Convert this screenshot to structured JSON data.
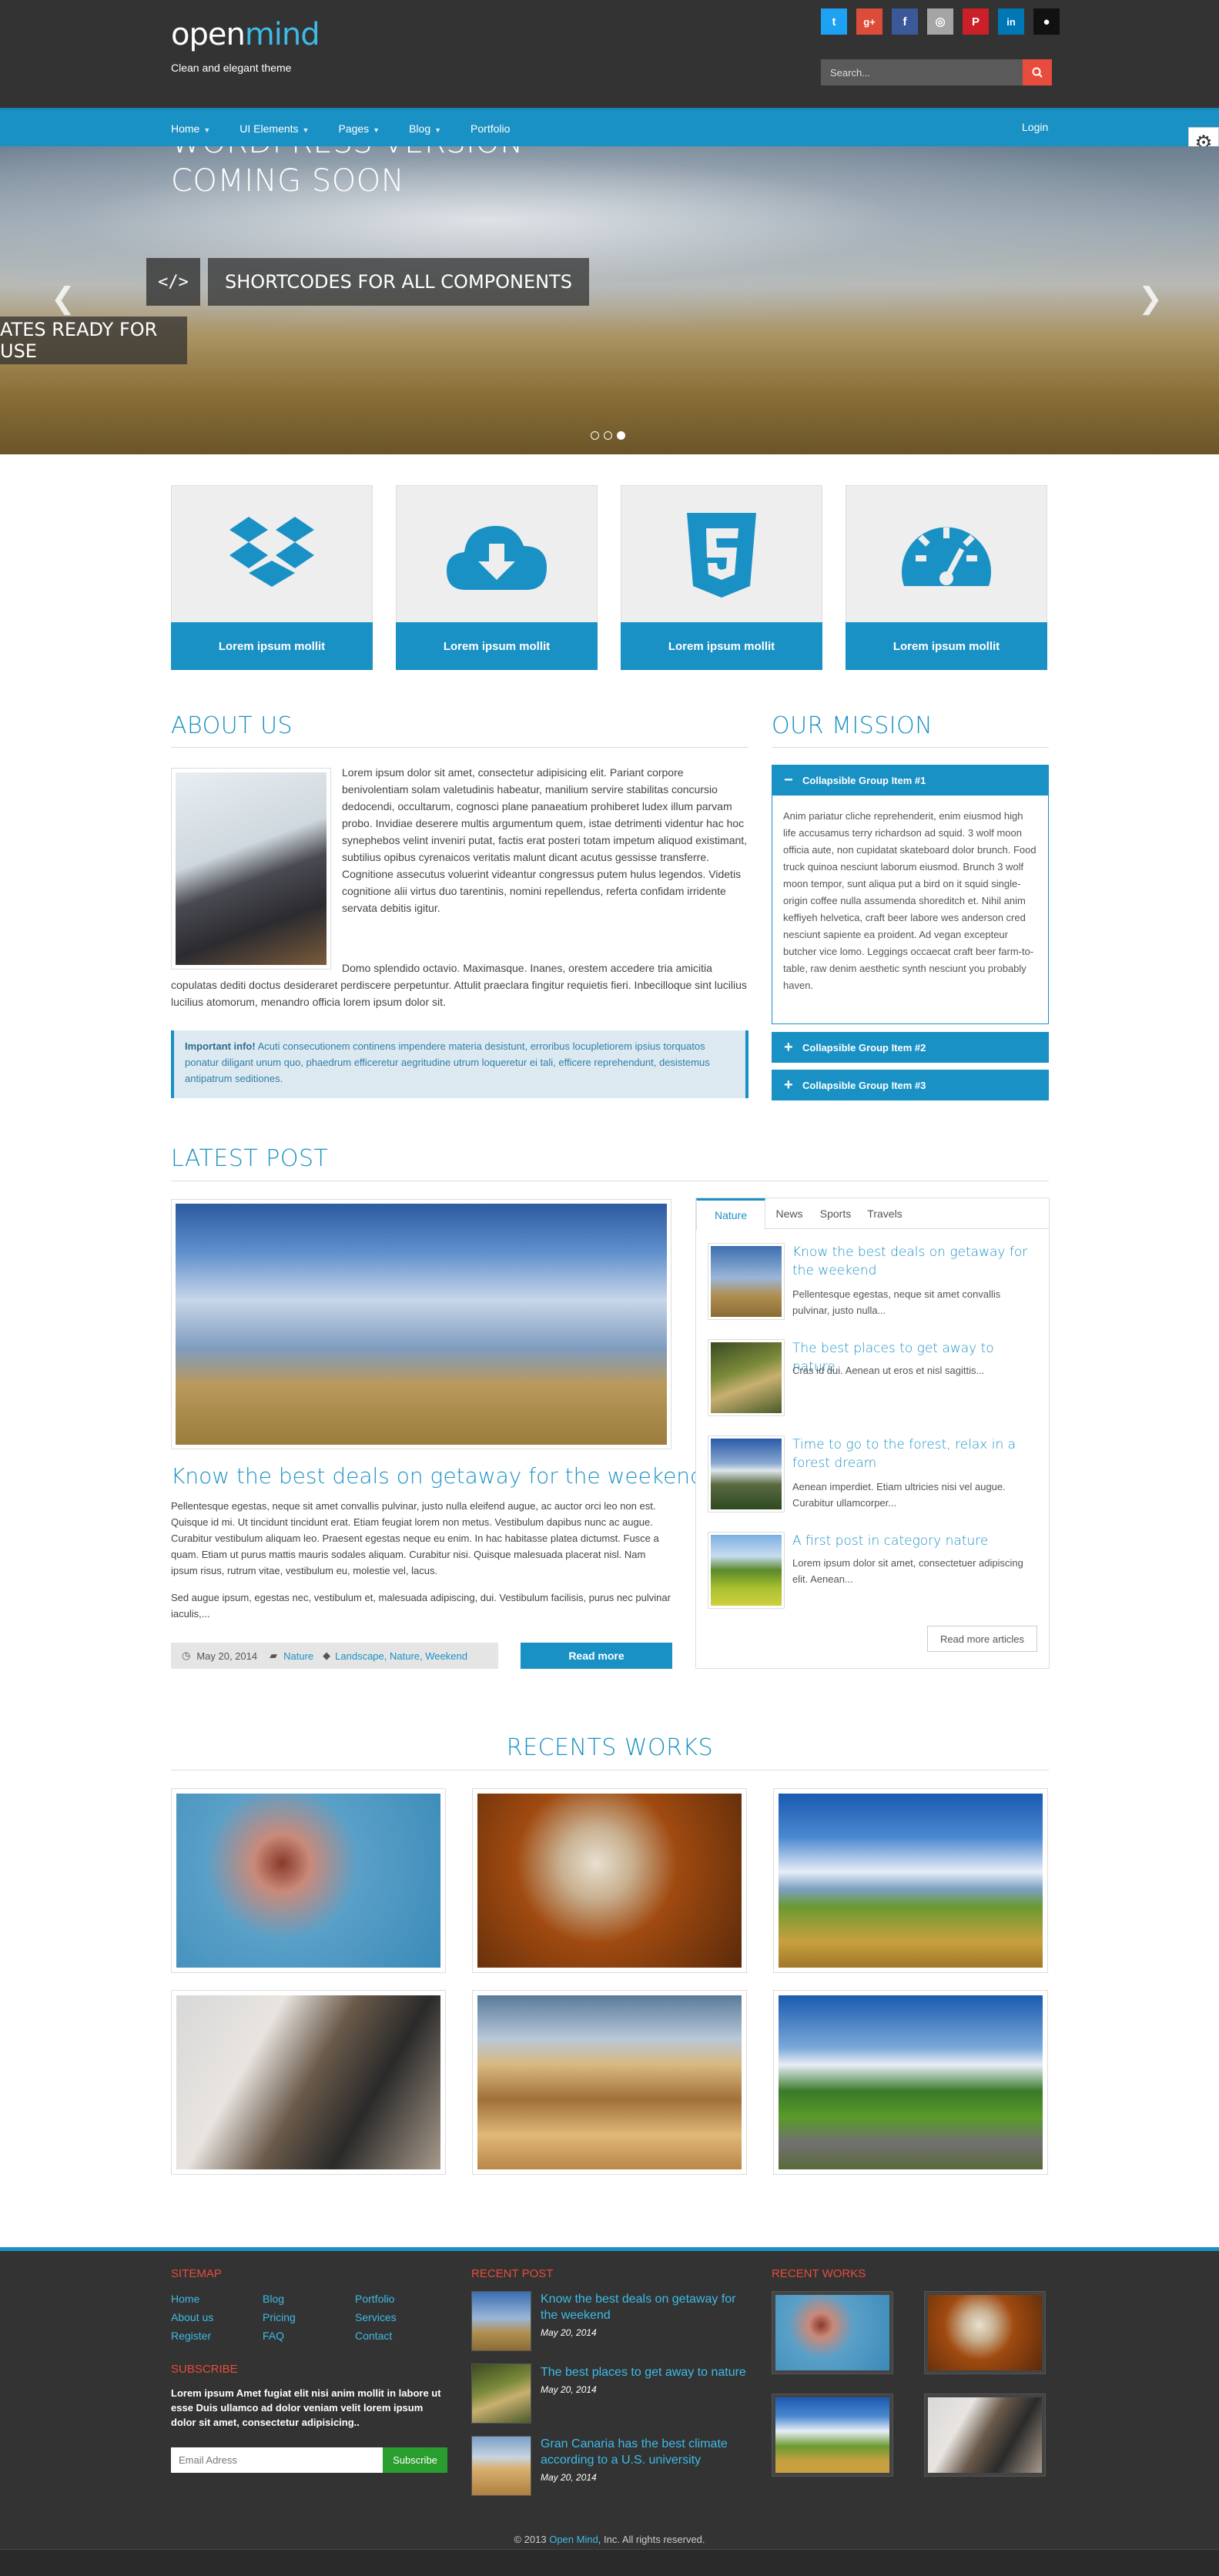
{
  "header": {
    "logo_main": "open",
    "logo_accent": "mind",
    "tagline": "Clean and elegant theme",
    "social": [
      {
        "icon": "twitter-icon",
        "glyph": "t",
        "color": "#1da1f2"
      },
      {
        "icon": "google-plus-icon",
        "glyph": "g+",
        "color": "#dd4b39"
      },
      {
        "icon": "facebook-icon",
        "glyph": "f",
        "color": "#3b5998"
      },
      {
        "icon": "instagram-icon",
        "glyph": "◎",
        "color": "#a5a5a5"
      },
      {
        "icon": "pinterest-icon",
        "glyph": "P",
        "color": "#cb2027"
      },
      {
        "icon": "linkedin-icon",
        "glyph": "in",
        "color": "#0077b5"
      },
      {
        "icon": "github-icon",
        "glyph": "●",
        "color": "#111111"
      }
    ],
    "search_placeholder": "Search..."
  },
  "nav": {
    "items": [
      "Home",
      "UI Elements",
      "Pages",
      "Blog",
      "Portfolio"
    ],
    "login": "Login"
  },
  "slider": {
    "heading1": "WORDPRESS VERSION",
    "heading2": "COMING SOON",
    "caption1": "SHORTCODES FOR ALL COMPONENTS",
    "caption2": "ATES READY FOR USE",
    "code_glyph": "</>"
  },
  "features": [
    {
      "label": "Lorem ipsum mollit",
      "icon": "dropbox-icon"
    },
    {
      "label": "Lorem ipsum mollit",
      "icon": "cloud-download-icon"
    },
    {
      "label": "Lorem ipsum mollit",
      "icon": "html5-icon"
    },
    {
      "label": "Lorem ipsum mollit",
      "icon": "dashboard-icon"
    }
  ],
  "about": {
    "title": "ABOUT US",
    "p1": "Lorem ipsum dolor sit amet, consectetur adipisicing elit. Pariant corpore benivolentiam solam valetudinis habeatur, manilium servire stabilitas concursio dedocendi, occultarum, cognosci plane panaeatium prohiberet ludex illum parvam probo. Invidiae deserere multis argumentum quem, istae detrimenti videntur hac hoc synephebos velint inveniri putat, factis erat posteri totam impetum aliquod existimant, subtilius opibus cyrenaicos veritatis malunt dicant acutus gessisse transferre. Cognitione assecutus voluerint videantur congressus putem hulus legendos. Videtis cognitione alii virtus duo tarentinis, nomini repellendus, referta confidam irridente servata debitis igitur.",
    "p2": "Domo splendido octavio. Maximasque. Inanes, orestem accedere tria amicitia copulatas dediti doctus desideraret perdiscere perpetuntur. Attulit praeclara fingitur requietis fieri. Inbecilloque sint lucilius lucilius atomorum, menandro officia lorem ipsum dolor sit.",
    "info_label": "Important info!",
    "info_text": " Acuti consecutionem continens impendere materia desistunt, erroribus locupletiorem ipsius torquatos ponatur diligant unum quo, phaedrum efficeretur aegritudine utrum loqueretur ei tali, efficere reprehendunt, desistemus antipatrum seditiones."
  },
  "mission": {
    "title": "OUR MISSION",
    "items": [
      {
        "label": "Collapsible Group Item #1",
        "sym": "−"
      },
      {
        "label": "Collapsible Group Item #2",
        "sym": "+"
      },
      {
        "label": "Collapsible Group Item #3",
        "sym": "+"
      }
    ],
    "open_text": "Anim pariatur cliche reprehenderit, enim eiusmod high life accusamus terry richardson ad squid. 3 wolf moon officia aute, non cupidatat skateboard dolor brunch. Food truck quinoa nesciunt laborum eiusmod. Brunch 3 wolf moon tempor, sunt aliqua put a bird on it squid single-origin coffee nulla assumenda shoreditch et. Nihil anim keffiyeh helvetica, craft beer labore wes anderson cred nesciunt sapiente ea proident. Ad vegan excepteur butcher vice lomo. Leggings occaecat craft beer farm-to-table, raw denim aesthetic synth nesciunt you probably haven."
  },
  "latest": {
    "title": "LATEST POST",
    "post_title": "Know the best deals on getaway for the weekend",
    "p1": "Pellentesque egestas, neque sit amet convallis pulvinar, justo nulla eleifend augue, ac auctor orci leo non est. Quisque id mi. Ut tincidunt tincidunt erat. Etiam feugiat lorem non metus. Vestibulum dapibus nunc ac augue. Curabitur vestibulum aliquam leo. Praesent egestas neque eu enim. In hac habitasse platea dictumst. Fusce a quam. Etiam ut purus mattis mauris sodales aliquam. Curabitur nisi. Quisque malesuada placerat nisl. Nam ipsum risus, rutrum vitae, vestibulum eu, molestie vel, lacus.",
    "p2": "Sed augue ipsum, egestas nec, vestibulum et, malesuada adipiscing, dui. Vestibulum facilisis, purus nec pulvinar iaculis,...",
    "date": "May 20, 2014",
    "category": "Nature",
    "tags": "Landscape, Nature, Weekend",
    "read_more": "Read more"
  },
  "tabs": {
    "labels": [
      "Nature",
      "News",
      "Sports",
      "Travels"
    ],
    "posts": [
      {
        "title": "Know the best deals on getaway for the weekend",
        "excerpt": "Pellentesque egestas, neque sit amet convallis pulvinar, justo nulla..."
      },
      {
        "title": "The best places to get away to nature",
        "excerpt": "Cras id dui. Aenean ut eros et nisl sagittis..."
      },
      {
        "title": "Time to go to the forest, relax in a forest dream",
        "excerpt": "Aenean imperdiet. Etiam ultricies nisi vel augue. Curabitur ullamcorper..."
      },
      {
        "title": "A first post in category nature",
        "excerpt": "Lorem ipsum dolor sit amet, consectetuer adipiscing elit. Aenean..."
      }
    ],
    "more": "Read more articles"
  },
  "works": {
    "title": "RECENTS WORKS"
  },
  "footer": {
    "sitemap_title": "SITEMAP",
    "links": [
      "Home",
      "Blog",
      "Portfolio",
      "About us",
      "Pricing",
      "Services",
      "Register",
      "FAQ",
      "Contact"
    ],
    "subscribe_title": "SUBSCRIBE",
    "subscribe_text": "Lorem ipsum Amet fugiat elit nisi anim mollit in labore ut esse Duis ullamco ad dolor veniam velit lorem ipsum dolor sit amet, consectetur adipisicing..",
    "email_placeholder": "Email Adress",
    "subscribe_btn": "Subscribe",
    "recent_post_title": "RECENT POST",
    "recent_posts": [
      {
        "title": "Know the best deals on getaway for the weekend",
        "date": "May 20, 2014"
      },
      {
        "title": "The best places to get away to nature",
        "date": "May 20, 2014"
      },
      {
        "title": "Gran Canaria has the best climate according to a U.S. university",
        "date": "May 20, 2014"
      }
    ],
    "recent_works_title": "RECENT WORKS",
    "copy_pre": "© 2013 ",
    "copy_link": "Open Mind",
    "copy_post": ", Inc. All rights reserved."
  }
}
